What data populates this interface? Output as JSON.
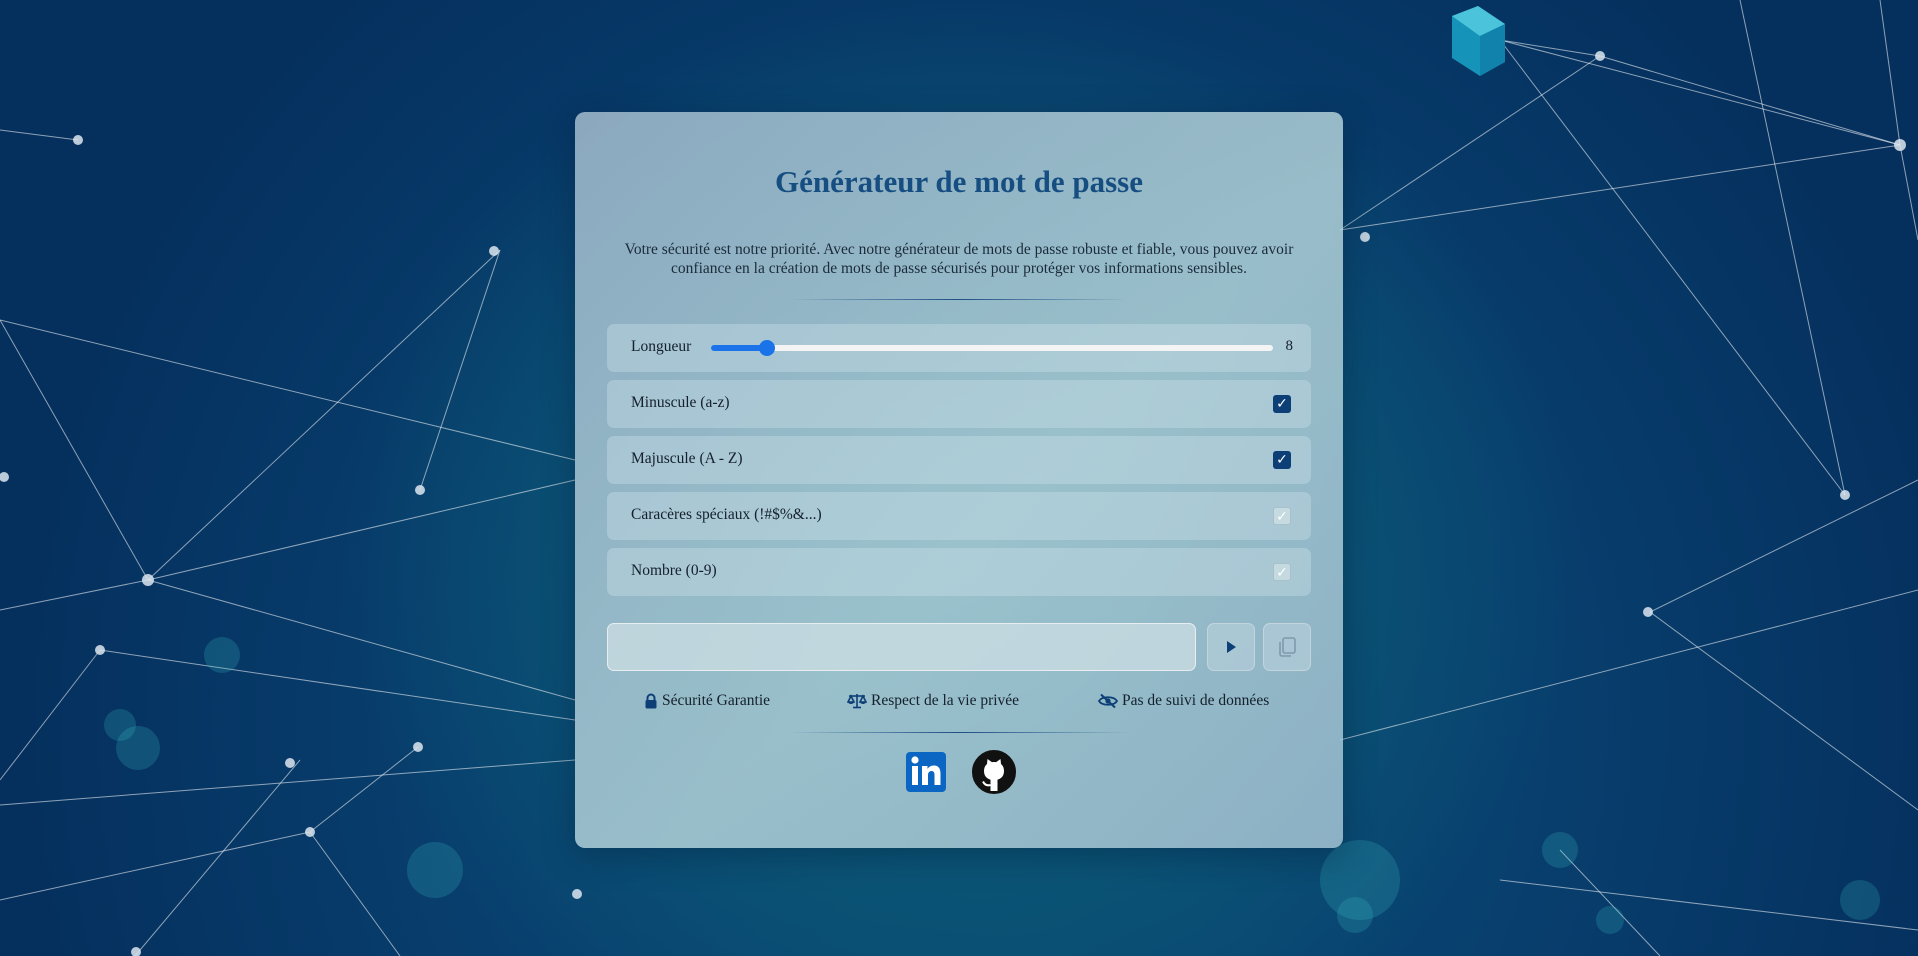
{
  "page": {
    "title": "Générateur de mot de passe",
    "description": "Votre sécurité est notre priorité. Avec notre générateur de mots de passe robuste et fiable, vous pouvez avoir confiance en la création de mots de passe sécurisés pour protéger vos informations sensibles."
  },
  "length": {
    "label": "Longueur",
    "value": 8,
    "value_text": "8",
    "min": 4,
    "max": 44
  },
  "options": [
    {
      "label": "Minuscule (a-z)",
      "checked": true
    },
    {
      "label": "Majuscule (A - Z)",
      "checked": true
    },
    {
      "label": "Caracères spéciaux (!#$%&...)",
      "checked": false
    },
    {
      "label": "Nombre (0-9)",
      "checked": false
    }
  ],
  "output": {
    "value": "",
    "placeholder": ""
  },
  "actions": {
    "generate_icon": "play-icon",
    "copy_icon": "copy-icon"
  },
  "features": [
    {
      "icon": "lock-icon",
      "label": "Sécurité Garantie"
    },
    {
      "icon": "scale-icon",
      "label": "Respect de la vie privée"
    },
    {
      "icon": "eye-slash-icon",
      "label": "Pas de suivi de données"
    }
  ],
  "social": [
    {
      "icon": "linkedin-icon"
    },
    {
      "icon": "github-icon"
    }
  ],
  "colors": {
    "title": "#164e82",
    "slider": "#1a73e8",
    "checkbox_checked": "#0d3f77",
    "linkedin": "#0a66c2"
  }
}
